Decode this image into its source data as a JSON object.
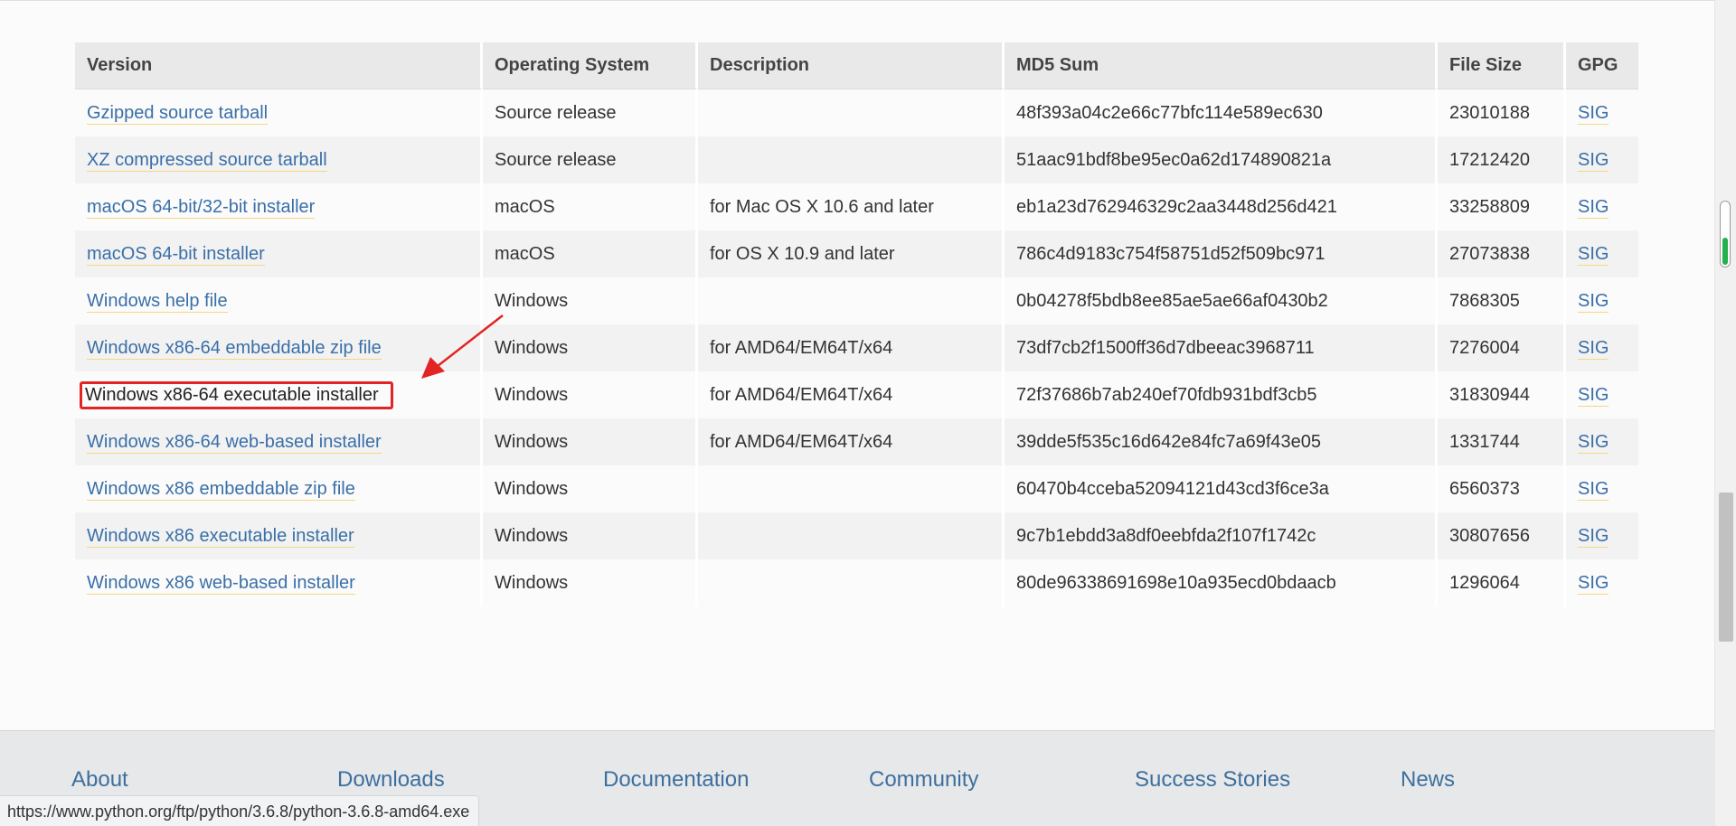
{
  "table": {
    "headers": {
      "version": "Version",
      "os": "Operating System",
      "description": "Description",
      "md5": "MD5 Sum",
      "size": "File Size",
      "gpg": "GPG"
    },
    "rows": [
      {
        "version": "Gzipped source tarball",
        "os": "Source release",
        "description": "",
        "md5": "48f393a04c2e66c77bfc114e589ec630",
        "size": "23010188",
        "gpg": "SIG"
      },
      {
        "version": "XZ compressed source tarball",
        "os": "Source release",
        "description": "",
        "md5": "51aac91bdf8be95ec0a62d174890821a",
        "size": "17212420",
        "gpg": "SIG"
      },
      {
        "version": "macOS 64-bit/32-bit installer",
        "os": "macOS",
        "description": "for Mac OS X 10.6 and later",
        "md5": "eb1a23d762946329c2aa3448d256d421",
        "size": "33258809",
        "gpg": "SIG"
      },
      {
        "version": "macOS 64-bit installer",
        "os": "macOS",
        "description": "for OS X 10.9 and later",
        "md5": "786c4d9183c754f58751d52f509bc971",
        "size": "27073838",
        "gpg": "SIG"
      },
      {
        "version": "Windows help file",
        "os": "Windows",
        "description": "",
        "md5": "0b04278f5bdb8ee85ae5ae66af0430b2",
        "size": "7868305",
        "gpg": "SIG"
      },
      {
        "version": "Windows x86-64 embeddable zip file",
        "os": "Windows",
        "description": "for AMD64/EM64T/x64",
        "md5": "73df7cb2f1500ff36d7dbeeac3968711",
        "size": "7276004",
        "gpg": "SIG"
      },
      {
        "version": "Windows x86-64 executable installer",
        "os": "Windows",
        "description": "for AMD64/EM64T/x64",
        "md5": "72f37686b7ab240ef70fdb931bdf3cb5",
        "size": "31830944",
        "gpg": "SIG"
      },
      {
        "version": "Windows x86-64 web-based installer",
        "os": "Windows",
        "description": "for AMD64/EM64T/x64",
        "md5": "39dde5f535c16d642e84fc7a69f43e05",
        "size": "1331744",
        "gpg": "SIG"
      },
      {
        "version": "Windows x86 embeddable zip file",
        "os": "Windows",
        "description": "",
        "md5": "60470b4cceba52094121d43cd3f6ce3a",
        "size": "6560373",
        "gpg": "SIG"
      },
      {
        "version": "Windows x86 executable installer",
        "os": "Windows",
        "description": "",
        "md5": "9c7b1ebdd3a8df0eebfda2f107f1742c",
        "size": "30807656",
        "gpg": "SIG"
      },
      {
        "version": "Windows x86 web-based installer",
        "os": "Windows",
        "description": "",
        "md5": "80de96338691698e10a935ecd0bdaacb",
        "size": "1296064",
        "gpg": "SIG"
      }
    ]
  },
  "highlight": {
    "row_index": 6,
    "color": "#e32424"
  },
  "footer": {
    "nav": [
      "About",
      "Downloads",
      "Documentation",
      "Community",
      "Success Stories",
      "News"
    ]
  },
  "status_bar": {
    "url": "https://www.python.org/ftp/python/3.6.8/python-3.6.8-amd64.exe"
  },
  "colors": {
    "link": "#3a6fa8",
    "link_underline": "#f3d77e",
    "header_bg": "#e9e9e9",
    "footer_bg": "#e6e8ea",
    "footer_link": "#3d6f9e",
    "scroll_marker": "#23b14d"
  }
}
